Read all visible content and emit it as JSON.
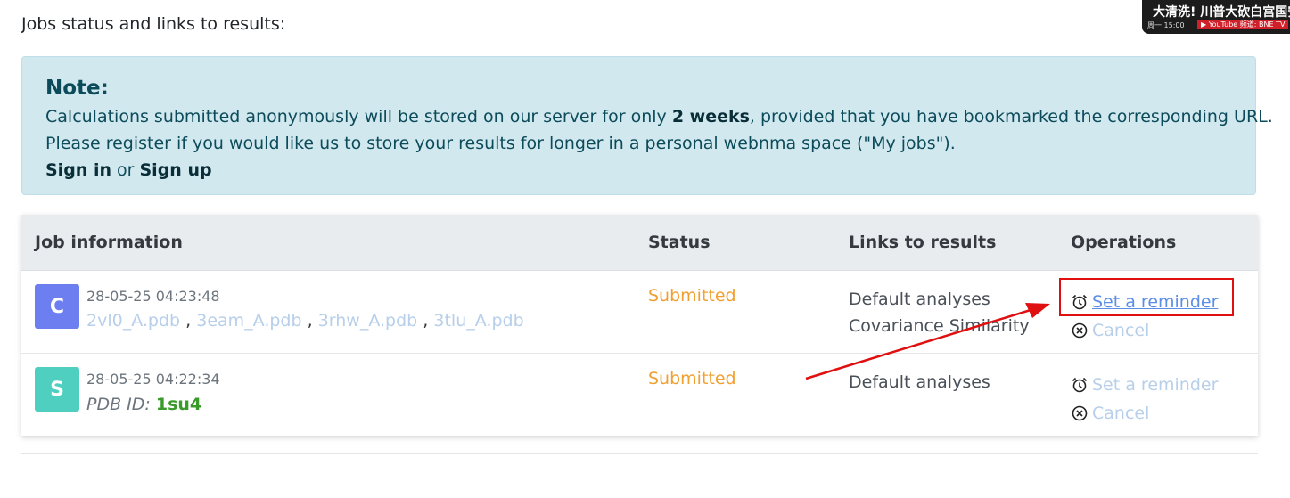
{
  "heading": "Jobs status and links to results:",
  "note": {
    "title": "Note:",
    "line1_pre": "Calculations submitted anonymously will be stored on our server for only ",
    "line1_bold": "2 weeks",
    "line1_post": ", provided that you have bookmarked the corresponding URL.",
    "line2": "Please register if you would like us to store your results for longer in a personal webnma space (\"My jobs\").",
    "sign_in": "Sign in",
    "or": " or ",
    "sign_up": "Sign up"
  },
  "table": {
    "headers": [
      "Job information",
      "Status",
      "Links to results",
      "Operations"
    ],
    "rows": [
      {
        "avatar": "C",
        "date": "28-05-25 04:23:48",
        "files": [
          "2vl0_A.pdb",
          "3eam_A.pdb",
          "3rhw_A.pdb",
          "3tlu_A.pdb"
        ],
        "separator": ",",
        "status": "Submitted",
        "links": [
          "Default analyses",
          "Covariance Similarity"
        ],
        "ops": [
          "Set a reminder",
          "Cancel"
        ]
      },
      {
        "avatar": "S",
        "date": "28-05-25 04:22:34",
        "pdb_label": "PDB ID:",
        "pdb_id": "1su4",
        "status": "Submitted",
        "links": [
          "Default analyses"
        ],
        "ops": [
          "Set a reminder",
          "Cancel"
        ]
      }
    ]
  },
  "colors": {
    "note_bg": "#d1e8ef",
    "status": "#f0a030",
    "link_muted": "#b7cfea",
    "link_active": "#5b8fe6",
    "annotation": "#e01010"
  },
  "overlay": {
    "title": "大清洗! 川普大砍白宫国安会",
    "time": "周一 15:00",
    "tag": "▶ YouTube 频道: BNE TV"
  },
  "icons": [
    "alarm-clock-icon",
    "cancel-circle-icon",
    "arrow-annotation"
  ]
}
